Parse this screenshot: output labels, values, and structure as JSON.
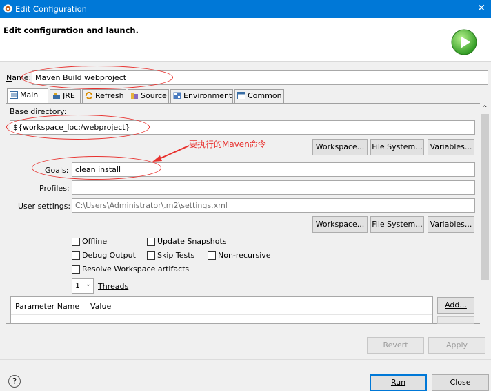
{
  "window": {
    "title": "Edit Configuration",
    "close_glyph": "✕"
  },
  "header": {
    "title": "Edit configuration and launch."
  },
  "name_field": {
    "label": "Name:",
    "value": "Maven Build webproject"
  },
  "tabs": [
    {
      "label": "Main",
      "icon": "main-tab-icon"
    },
    {
      "label": "JRE",
      "icon": "jre-icon"
    },
    {
      "label": "Refresh",
      "icon": "refresh-icon"
    },
    {
      "label": "Source",
      "icon": "source-icon"
    },
    {
      "label": "Environment",
      "icon": "environment-icon"
    },
    {
      "label": "Common",
      "icon": "common-icon"
    }
  ],
  "main": {
    "base_directory_label": "Base directory:",
    "base_directory_value": "${workspace_loc:/webproject}",
    "annotation": "要执行的Maven命令",
    "workspace_button": "Workspace...",
    "filesystem_button": "File System...",
    "variables_button": "Variables...",
    "goals_label": "Goals:",
    "goals_value": "clean install",
    "profiles_label": "Profiles:",
    "profiles_value": "",
    "user_settings_label": "User settings:",
    "user_settings_value": "C:\\Users\\Administrator\\.m2\\settings.xml",
    "checkboxes": {
      "offline": "Offline",
      "update_snapshots": "Update Snapshots",
      "debug_output": "Debug Output",
      "skip_tests": "Skip Tests",
      "non_recursive": "Non-recursive",
      "resolve_workspace": "Resolve Workspace artifacts"
    },
    "threads_value": "1",
    "threads_label": "Threads",
    "table_headers": [
      "Parameter Name",
      "Value"
    ],
    "add_button": "Add..."
  },
  "footer": {
    "revert_button": "Revert",
    "apply_button": "Apply",
    "run_button": "Run",
    "close_button": "Close",
    "help_glyph": "?"
  },
  "colors": {
    "accent": "#0078d7",
    "annotation_red": "#e8312e"
  }
}
